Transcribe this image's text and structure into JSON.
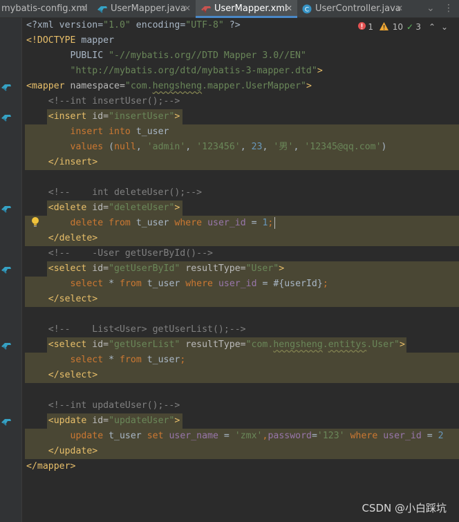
{
  "colors": {
    "editor_bg": "#2b2b2b",
    "highlight_bg": "#4a4734",
    "tag": "#e8bf6a",
    "string": "#6a8759",
    "comment": "#808080",
    "keyword": "#cc7832",
    "field": "#9876aa",
    "number": "#6897bb",
    "marker": "#be9117",
    "active_tab_underline": "#4a88c7"
  },
  "tabs": [
    {
      "label": "mybatis-config.xml",
      "icon": "xml-file-icon",
      "active": false
    },
    {
      "label": "UserMapper.java",
      "icon": "mybatis-mapper-icon",
      "active": false
    },
    {
      "label": "UserMapper.xml",
      "icon": "mybatis-xml-icon",
      "active": true
    },
    {
      "label": "UserController.java",
      "icon": "java-class-icon",
      "active": false
    },
    {
      "label": "",
      "icon": "overflow-tab-icon",
      "active": false
    }
  ],
  "inspection": {
    "errors": "1",
    "warnings": "10",
    "ok": "3"
  },
  "code_lines": [
    [
      [
        "t-plain",
        "<?xml version="
      ],
      [
        "t-str",
        "\"1.0\""
      ],
      [
        "t-plain",
        " encoding="
      ],
      [
        "t-str",
        "\"UTF-8\""
      ],
      [
        "t-plain",
        " ?>"
      ]
    ],
    [
      [
        "t-decl",
        "<!DOCTYPE"
      ],
      [
        "t-plain",
        " mapper"
      ]
    ],
    [
      [
        "t-plain",
        "        PUBLIC "
      ],
      [
        "t-str",
        "\"-//mybatis.org//DTD Mapper 3.0//EN\""
      ]
    ],
    [
      [
        "t-plain",
        "        "
      ],
      [
        "t-str",
        "\"http://mybatis.org/dtd/mybatis-3-mapper.dtd\""
      ],
      [
        "t-tag",
        ">"
      ]
    ],
    [
      [
        "t-tag",
        "<mapper"
      ],
      [
        "t-attr",
        " namespace="
      ],
      [
        "t-str",
        "\"com."
      ],
      [
        "t-str sq",
        "hengsheng"
      ],
      [
        "t-str",
        ".mapper.UserMapper\""
      ],
      [
        "t-tag",
        ">"
      ]
    ],
    [
      [
        "t-com",
        "    <!--int insertUser();-->"
      ]
    ],
    [
      [
        "t-tag",
        "    <insert"
      ],
      [
        "t-attr",
        " id="
      ],
      [
        "t-str",
        "\"insertUser\""
      ],
      [
        "t-tag",
        ">"
      ]
    ],
    [
      [
        "t-plain",
        "        "
      ],
      [
        "t-kw",
        "insert into"
      ],
      [
        "t-plain",
        " t_user"
      ]
    ],
    [
      [
        "t-plain",
        "        "
      ],
      [
        "t-kw",
        "values"
      ],
      [
        "t-plain",
        " ("
      ],
      [
        "t-kw",
        "null"
      ],
      [
        "t-plain",
        ", "
      ],
      [
        "t-str",
        "'admin'"
      ],
      [
        "t-plain",
        ", "
      ],
      [
        "t-str",
        "'123456'"
      ],
      [
        "t-plain",
        ", "
      ],
      [
        "t-num",
        "23"
      ],
      [
        "t-plain",
        ", "
      ],
      [
        "t-str",
        "'男'"
      ],
      [
        "t-plain",
        ", "
      ],
      [
        "t-str",
        "'12345@qq.com'"
      ],
      [
        "t-plain",
        ")"
      ]
    ],
    [
      [
        "t-tag",
        "    </insert>"
      ]
    ],
    [
      [
        "t-plain",
        ""
      ]
    ],
    [
      [
        "t-com",
        "    <!--    int deleteUser();-->"
      ]
    ],
    [
      [
        "t-tag",
        "    <delete"
      ],
      [
        "t-attr",
        " id="
      ],
      [
        "t-str",
        "\"deleteUser\""
      ],
      [
        "t-tag",
        ">"
      ]
    ],
    [
      [
        "t-plain",
        "        "
      ],
      [
        "t-kw",
        "delete from"
      ],
      [
        "t-plain",
        " t_user "
      ],
      [
        "t-kw",
        "where"
      ],
      [
        "t-plain",
        " "
      ],
      [
        "t-fld",
        "user_id"
      ],
      [
        "t-plain",
        " = "
      ],
      [
        "t-num",
        "1"
      ],
      [
        "t-kw",
        ";"
      ]
    ],
    [
      [
        "t-tag",
        "    </delete>"
      ]
    ],
    [
      [
        "t-com",
        "    <!--    -User getUserById()-->"
      ]
    ],
    [
      [
        "t-tag",
        "    <select"
      ],
      [
        "t-attr",
        " id="
      ],
      [
        "t-str",
        "\"getUserById\""
      ],
      [
        "t-attr",
        " resultType="
      ],
      [
        "t-str",
        "\"User\""
      ],
      [
        "t-tag",
        ">"
      ]
    ],
    [
      [
        "t-plain",
        "        "
      ],
      [
        "t-kw",
        "select"
      ],
      [
        "t-plain",
        " * "
      ],
      [
        "t-kw",
        "from"
      ],
      [
        "t-plain",
        " t_user "
      ],
      [
        "t-kw",
        "where"
      ],
      [
        "t-plain",
        " "
      ],
      [
        "t-fld",
        "user_id"
      ],
      [
        "t-plain",
        " = #{userId}"
      ],
      [
        "t-kw",
        ";"
      ]
    ],
    [
      [
        "t-tag",
        "    </select>"
      ]
    ],
    [
      [
        "t-plain",
        ""
      ]
    ],
    [
      [
        "t-com",
        "    <!--    List<User> getUserList();-->"
      ]
    ],
    [
      [
        "t-tag",
        "    <select"
      ],
      [
        "t-attr",
        " id="
      ],
      [
        "t-str",
        "\"getUserList\""
      ],
      [
        "t-attr",
        " resultType="
      ],
      [
        "t-str",
        "\"com."
      ],
      [
        "t-str sq",
        "hengsheng"
      ],
      [
        "t-str",
        "."
      ],
      [
        "t-str sq",
        "entitys"
      ],
      [
        "t-str",
        ".User\""
      ],
      [
        "t-tag",
        ">"
      ]
    ],
    [
      [
        "t-plain",
        "        "
      ],
      [
        "t-kw",
        "select"
      ],
      [
        "t-plain",
        " * "
      ],
      [
        "t-kw",
        "from"
      ],
      [
        "t-plain",
        " t_user"
      ],
      [
        "t-kw",
        ";"
      ]
    ],
    [
      [
        "t-tag",
        "    </select>"
      ]
    ],
    [
      [
        "t-plain",
        ""
      ]
    ],
    [
      [
        "t-com",
        "    <!--int updateUser();-->"
      ]
    ],
    [
      [
        "t-tag",
        "    <update"
      ],
      [
        "t-attr",
        " id="
      ],
      [
        "t-str",
        "\"updateUser\""
      ],
      [
        "t-tag",
        ">"
      ]
    ],
    [
      [
        "t-plain",
        "        "
      ],
      [
        "t-kw",
        "update"
      ],
      [
        "t-plain",
        " t_user "
      ],
      [
        "t-kw",
        "set"
      ],
      [
        "t-plain",
        " "
      ],
      [
        "t-fld",
        "user_name"
      ],
      [
        "t-plain",
        " = "
      ],
      [
        "t-str",
        "'zmx'"
      ],
      [
        "t-kw",
        ","
      ],
      [
        "t-fld",
        "password"
      ],
      [
        "t-plain",
        "="
      ],
      [
        "t-str",
        "'123'"
      ],
      [
        "t-plain",
        " "
      ],
      [
        "t-kw",
        "where"
      ],
      [
        "t-plain",
        " "
      ],
      [
        "t-fld",
        "user_id"
      ],
      [
        "t-plain",
        " = "
      ],
      [
        "t-num",
        "2"
      ]
    ],
    [
      [
        "t-tag",
        "    </update>"
      ]
    ],
    [
      [
        "t-tag",
        "</mapper>"
      ]
    ]
  ],
  "watermark": "CSDN @小白踩坑"
}
